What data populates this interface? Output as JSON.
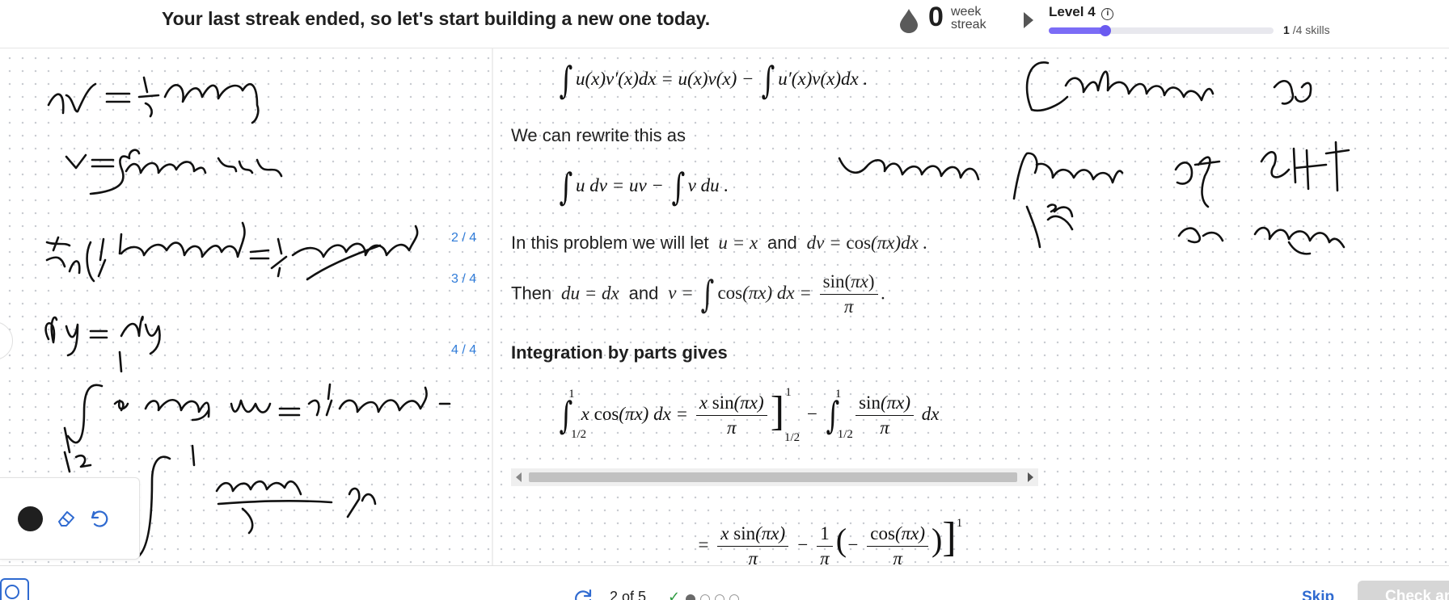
{
  "header": {
    "streak_message": "Your last streak ended, so let's start building a new one today.",
    "streak_count": "0",
    "streak_label_1": "week",
    "streak_label_2": "streak",
    "level_title": "Level 4",
    "level_info_icon": "info-icon",
    "level_progress_fraction": 0.25,
    "skills_done": "1",
    "skills_total": "/4 skills",
    "accent_color": "#7b6cf6"
  },
  "steps": {
    "s2": "2 / 4",
    "s3": "3 / 4",
    "s4": "4 / 4"
  },
  "solution": {
    "rewrite_text": "We can rewrite this as",
    "let_prefix": "In this problem we will let",
    "let_and": "and",
    "then_prefix": "Then",
    "then_and": "and",
    "ibp_heading": "Integration by parts gives"
  },
  "tools": {
    "pen_color": "#1f1f1f",
    "eraser_icon": "eraser-icon",
    "undo_icon": "undo-icon"
  },
  "footer": {
    "progress_text": "2 of 5",
    "check_glyph": "✓",
    "progress_dots_total": 4,
    "progress_dot_active": 0,
    "skip_label": "Skip",
    "check_label": "Check answer",
    "link_color": "#2f6ad0"
  }
}
